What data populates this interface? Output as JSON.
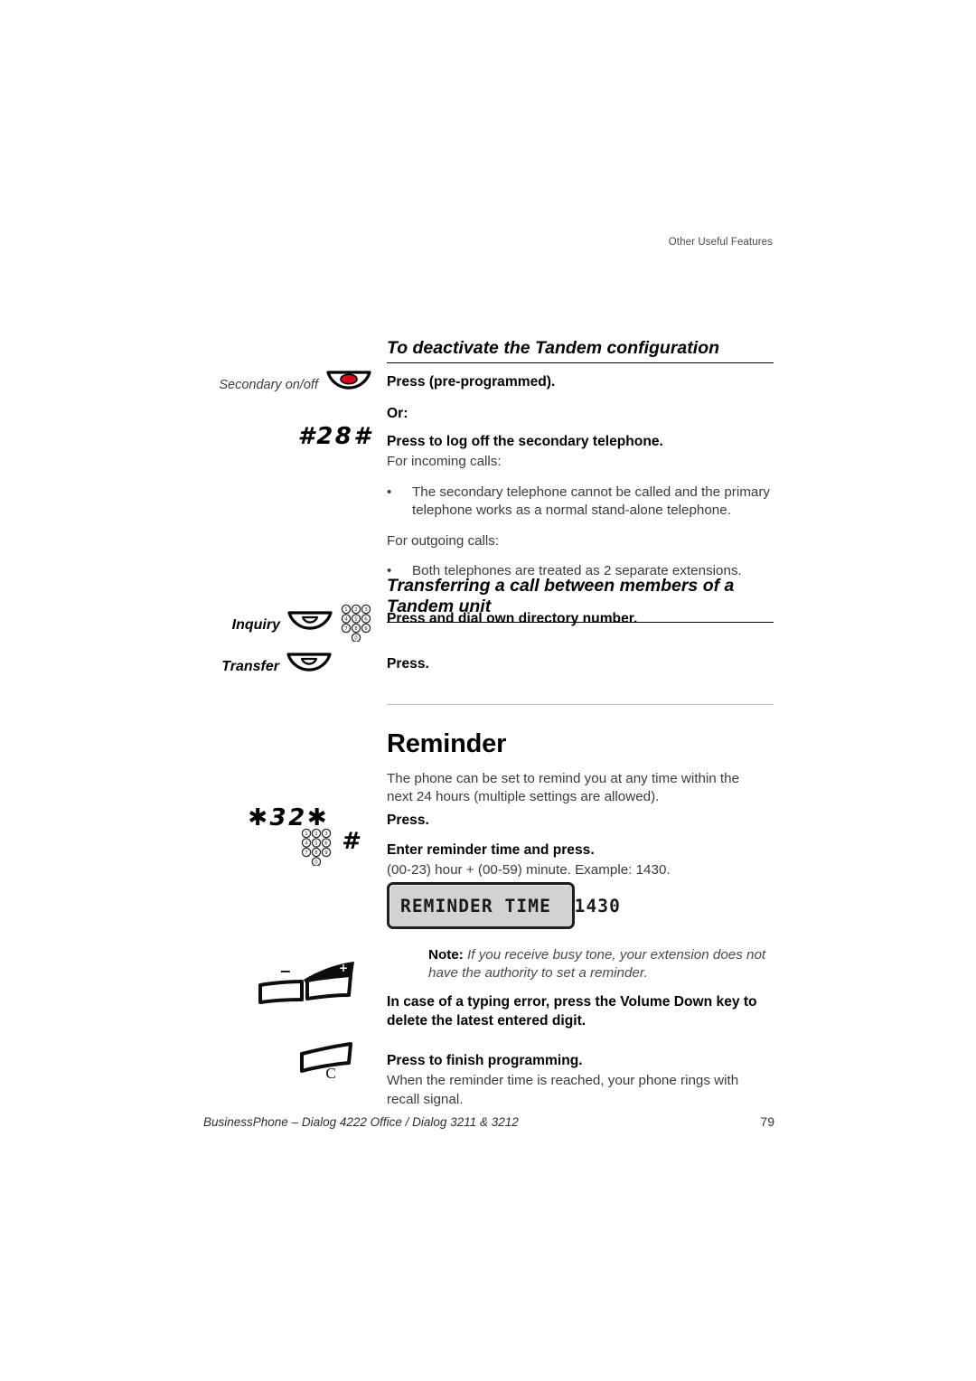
{
  "header": {
    "running_head": "Other Useful Features"
  },
  "section_tandem": {
    "heading_deactivate": "To deactivate the Tandem configuration",
    "key_label_secondary": "Secondary on/off",
    "instr_press_preprogrammed": "Press (pre-programmed).",
    "or_label": "Or:",
    "code_28": "#28#",
    "instr_log_off": "Press to log off the secondary telephone.",
    "incoming_lead": "For incoming calls:",
    "bullet_incoming": "The secondary telephone cannot be called and the primary telephone works as a normal stand-alone telephone.",
    "outgoing_lead": "For outgoing calls:",
    "bullet_outgoing_pre": "Both telephones are treated as ",
    "bullet_outgoing_underlined": "2 separate extensions",
    "bullet_outgoing_post": ".",
    "bullet_glyph": "•"
  },
  "section_transfer": {
    "heading_transfer": "Transferring a call between members of a Tandem unit",
    "key_label_inquiry": "Inquiry",
    "key_label_transfer": "Transfer",
    "instr_dial_own": "Press and dial own directory number.",
    "instr_press": "Press."
  },
  "section_reminder": {
    "title": "Reminder",
    "intro": "The phone can be set to remind you at any time within the next 24 hours (multiple settings are allowed).",
    "code_32": "✱32✱",
    "hash_glyph": "#",
    "instr_press": "Press.",
    "instr_enter_time": "Enter reminder time and press.",
    "time_format": "(00-23) hour + (00-59) minute. Example: 1430.",
    "lcd_text": "REMINDER TIME  1430",
    "note_label": "Note:",
    "note_text": " If you receive busy tone, your extension does not have the authority to set a reminder.",
    "instr_typing_error": "In case of a typing error, press the Volume Down key to delete the latest entered digit.",
    "instr_finish": "Press to finish programming.",
    "finish_body": "When the reminder time is reached, your phone rings with recall signal.",
    "volume_minus": "−",
    "volume_plus": "+",
    "clear_key_label": "C"
  },
  "footer": {
    "document_line": "BusinessPhone – Dialog 4222 Office / Dialog  3211 & 3212",
    "page_number": "79"
  },
  "colors": {
    "lamp_red": "#e3001b",
    "lcd_background": "#d2d2d2",
    "ink": "#1a1a1a"
  }
}
